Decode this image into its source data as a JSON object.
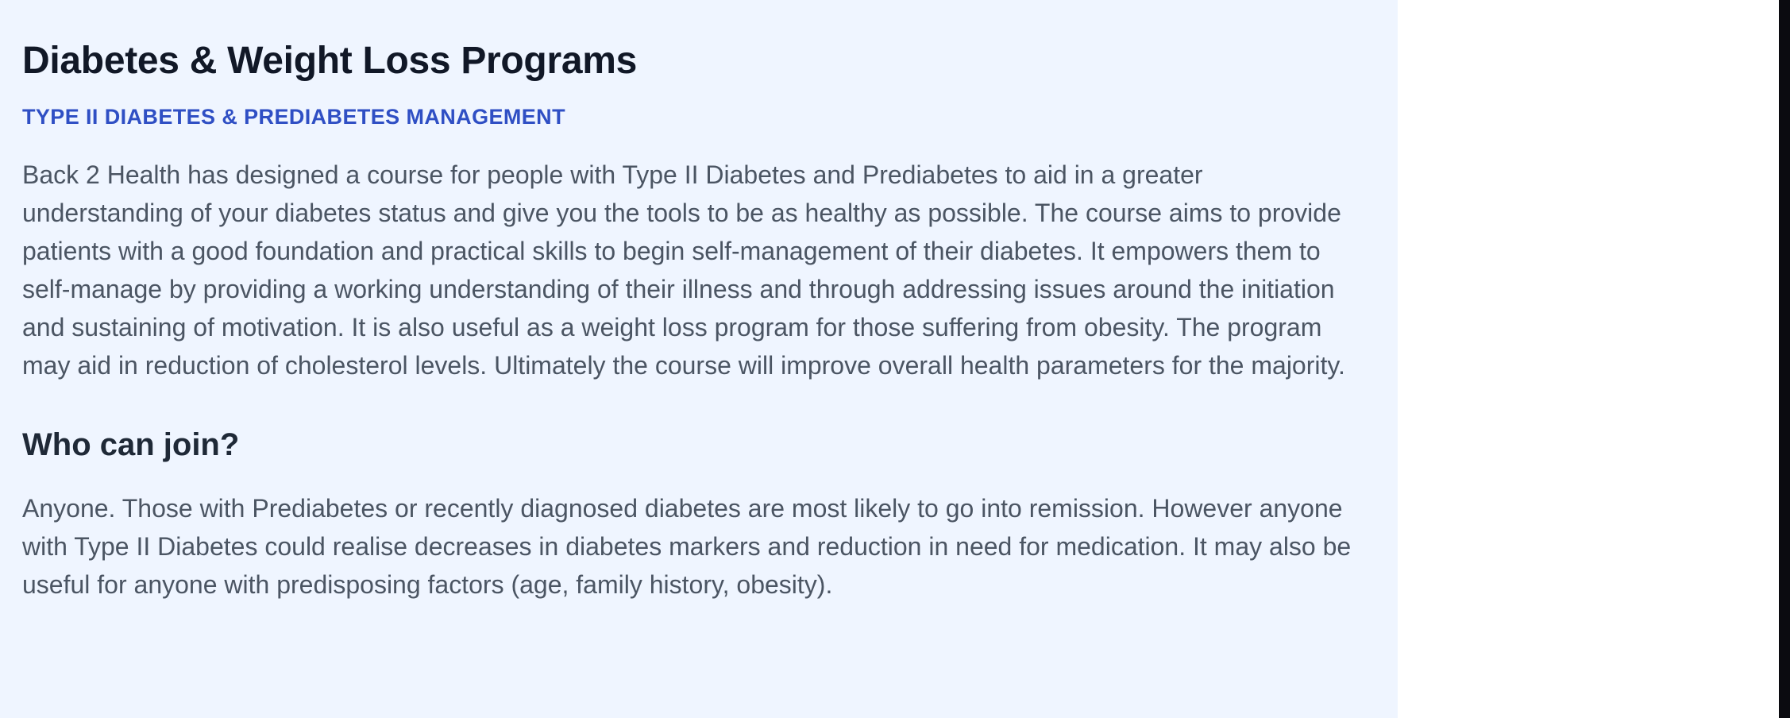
{
  "main": {
    "title": "Diabetes & Weight Loss Programs",
    "subtitle": "TYPE II DIABETES & PREDIABETES MANAGEMENT",
    "intro": "Back 2 Health has designed a course for people with Type II Diabetes and Prediabetes to aid in a greater understanding of your diabetes status and give you the tools to be as healthy as possible. The course aims to provide patients with a good foundation and practical skills to begin self-management of their diabetes. It empowers them to self-manage by providing a working understanding of their illness and through addressing issues around the initiation and sustaining of motivation. It is also useful as a weight loss program for those suffering from obesity. The program may aid in reduction of cholesterol levels. Ultimately the course will improve overall health parameters for the majority.",
    "section_heading": "Who can join?",
    "section_text": "Anyone. Those with Prediabetes or recently diagnosed diabetes are most likely to go into remission. However anyone with Type II Diabetes could realise decreases in diabetes markers and reduction in need for medication. It may also be useful for anyone with predisposing factors (age, family history, obesity)."
  },
  "colors": {
    "panel_background": "#eff5ff",
    "subtitle_accent": "#2f4fc4",
    "heading_text": "#111827",
    "body_text": "#4b5563",
    "edge_bar": "#0b0b10"
  }
}
